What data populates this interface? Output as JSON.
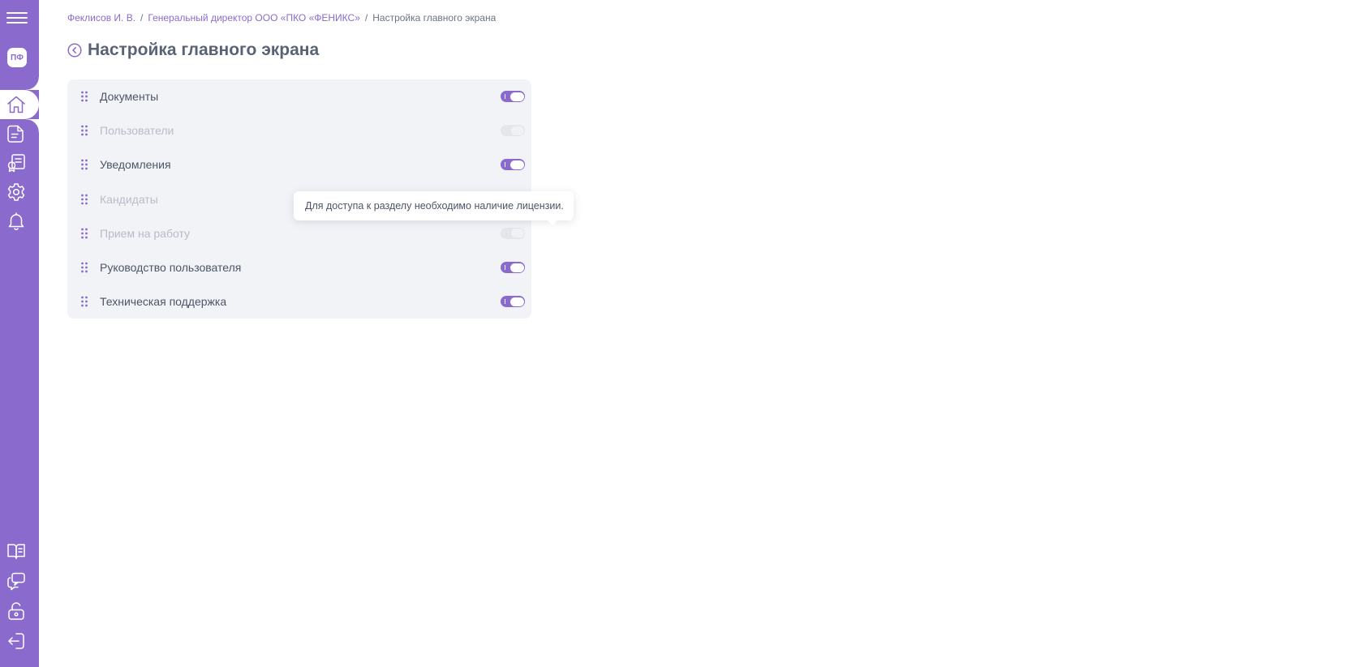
{
  "sidebar": {
    "logo_text": "ПФ",
    "top_items": [
      {
        "name": "home-icon",
        "active": true
      },
      {
        "name": "document-icon",
        "active": false
      },
      {
        "name": "certificate-icon",
        "active": false
      },
      {
        "name": "gear-icon",
        "active": false
      },
      {
        "name": "bell-icon",
        "active": false
      }
    ],
    "bottom_items": [
      {
        "name": "book-icon"
      },
      {
        "name": "support-chat-icon"
      },
      {
        "name": "unlock-icon"
      },
      {
        "name": "logout-icon"
      }
    ]
  },
  "breadcrumb": {
    "items": [
      "Феклисов И. В.",
      "Генеральный директор ООО «ПКО «ФЕНИКС»"
    ],
    "separator": "/",
    "current": "Настройка главного экрана"
  },
  "page": {
    "title": "Настройка главного экрана"
  },
  "settings": [
    {
      "label": "Документы",
      "enabled": true,
      "available": true
    },
    {
      "label": "Пользователи",
      "enabled": false,
      "available": false
    },
    {
      "label": "Уведомления",
      "enabled": true,
      "available": true
    },
    {
      "label": "Кандидаты",
      "enabled": false,
      "available": false
    },
    {
      "label": "Прием на работу",
      "enabled": false,
      "available": false
    },
    {
      "label": "Руководство пользователя",
      "enabled": true,
      "available": true
    },
    {
      "label": "Техническая поддержка",
      "enabled": true,
      "available": true
    }
  ],
  "tooltip": {
    "text": "Для доступа к разделу необходимо наличие лицензии."
  },
  "colors": {
    "accent": "#8a6bcd",
    "panel_bg": "#f2f3f7",
    "text": "#4d5566",
    "disabled_text": "#b8bcc8"
  }
}
